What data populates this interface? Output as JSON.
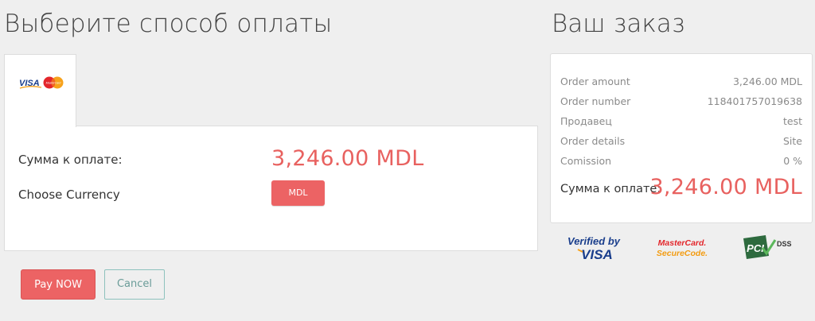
{
  "header": {
    "title": "Выберите способ оплаты",
    "order_title": "Ваш заказ"
  },
  "payment_tab": {
    "icon": "visa-mastercard-logo",
    "visa_text": "VISA",
    "mastercard_text": "MasterCard"
  },
  "payment_panel": {
    "amount_label": "Сумма к оплате:",
    "amount_value": "3,246.00 MDL",
    "currency_label": "Choose Currency",
    "currency_button": "MDL"
  },
  "actions": {
    "pay_label": "Pay NOW",
    "cancel_label": "Cancel"
  },
  "order": {
    "rows": [
      {
        "label": "Order amount",
        "value": "3,246.00 MDL"
      },
      {
        "label": "Order number",
        "value": "118401757019638"
      },
      {
        "label": "Продавец",
        "value": "test"
      },
      {
        "label": "Order details",
        "value": "Site"
      },
      {
        "label": "Comission",
        "value": "0 %"
      }
    ],
    "total_label": "Сумма к оплате:",
    "total_value": "3,246.00 MDL"
  },
  "security_logos": {
    "verified_line1": "Verified by",
    "verified_line2": "VISA",
    "mc_line1": "MasterCard.",
    "mc_line2": "SecureCode.",
    "pci_text": "PCI",
    "dss_text": "DSS"
  },
  "colors": {
    "accent": "#ec6364",
    "amount_text": "#e8615f",
    "cancel_border": "#8ec2bd",
    "background": "#efefef"
  }
}
